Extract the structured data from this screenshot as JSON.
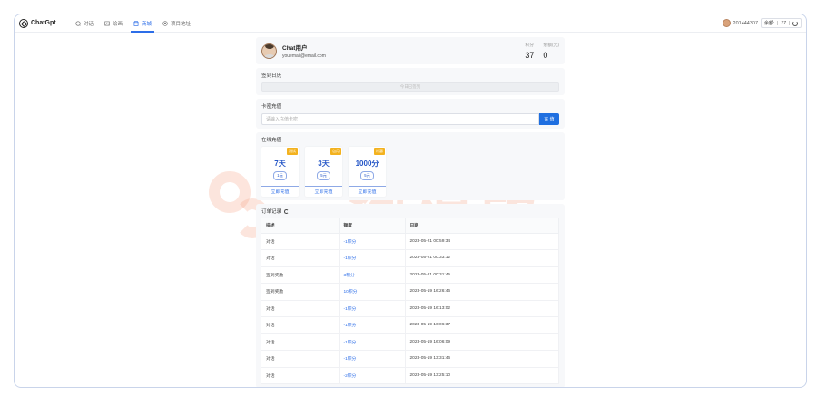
{
  "header": {
    "brand": "ChatGpt",
    "nav": [
      {
        "label": "对话",
        "icon": "chat-icon"
      },
      {
        "label": "绘画",
        "icon": "image-icon"
      },
      {
        "label": "商城",
        "icon": "store-icon",
        "active": true
      },
      {
        "label": "项目地址",
        "icon": "github-icon"
      }
    ],
    "user_id": "201444307",
    "balance_label": "余额:",
    "balance_value": "37"
  },
  "profile": {
    "name": "Chat用户",
    "email": "youemail@email.com",
    "points_label": "积分",
    "points_value": "37",
    "money_label": "余额(元)",
    "money_value": "0"
  },
  "signin": {
    "title": "签到日历",
    "button": "今日已签到"
  },
  "card_charge": {
    "title": "卡密充值",
    "placeholder": "请输入充值卡密",
    "button": "充 值"
  },
  "online": {
    "title": "在线充值",
    "packages": [
      {
        "tag": "测试",
        "amount": "7天",
        "price": "1元",
        "buy": "立即充值"
      },
      {
        "tag": "包月",
        "amount": "3天",
        "price": "5元",
        "buy": "立即充值"
      },
      {
        "tag": "特惠",
        "amount": "1000分",
        "price": "5元",
        "buy": "立即充值"
      }
    ]
  },
  "orders": {
    "title": "订单记录",
    "columns": [
      "描述",
      "额度",
      "日期"
    ],
    "rows": [
      [
        "对话",
        "-1积分",
        "2023-05-21 00:59:34"
      ],
      [
        "对话",
        "-1积分",
        "2023-05-21 00:33:12"
      ],
      [
        "签到奖励",
        "3积分",
        "2023-05-21 00:31:45"
      ],
      [
        "签到奖励",
        "10积分",
        "2023-05-19 16:26:46"
      ],
      [
        "对话",
        "-1积分",
        "2023-05-19 16:13:02"
      ],
      [
        "对话",
        "-1积分",
        "2023-05-19 16:06:37"
      ],
      [
        "对话",
        "-1积分",
        "2023-05-19 16:06:09"
      ],
      [
        "对话",
        "-1积分",
        "2023-05-19 13:31:46"
      ],
      [
        "对话",
        "-2积分",
        "2023-05-19 13:25:10"
      ]
    ]
  },
  "watermark": {
    "text": "一淘模版",
    "color": "#f0967a"
  }
}
